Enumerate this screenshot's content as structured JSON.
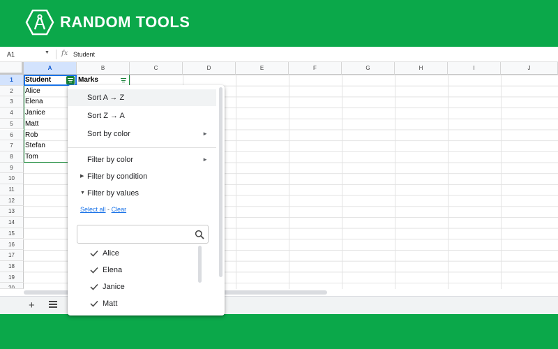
{
  "brand": {
    "name": "RANDOM TOOLS",
    "logo_icon": "compass-hexagon-icon",
    "color": "#0ba84a"
  },
  "formula_bar": {
    "cell_ref": "A1",
    "fx_label": "fx",
    "value": "Student"
  },
  "columns": [
    "A",
    "B",
    "C",
    "D",
    "E",
    "F",
    "G",
    "H",
    "I",
    "J"
  ],
  "rows": [
    "1",
    "2",
    "3",
    "4",
    "5",
    "6",
    "7",
    "8",
    "9",
    "10",
    "11",
    "12",
    "13",
    "14",
    "15",
    "16",
    "17",
    "18",
    "19",
    "20"
  ],
  "cells": {
    "headers": [
      "Student",
      "Marks"
    ],
    "students": [
      "Alice",
      "Elena",
      "Janice",
      "Matt",
      "Rob",
      "Stefan",
      "Tom"
    ]
  },
  "menu": {
    "sort_az": "Sort A → Z",
    "sort_za": "Sort Z → A",
    "sort_color": "Sort by color",
    "filter_color": "Filter by color",
    "filter_condition": "Filter by condition",
    "filter_values": "Filter by values",
    "select_all": "Select all",
    "link_sep": "-",
    "clear": "Clear",
    "search_placeholder": "",
    "values": [
      "Alice",
      "Elena",
      "Janice",
      "Matt"
    ]
  },
  "accent": "#1a73e8",
  "filter_color": "#188038"
}
